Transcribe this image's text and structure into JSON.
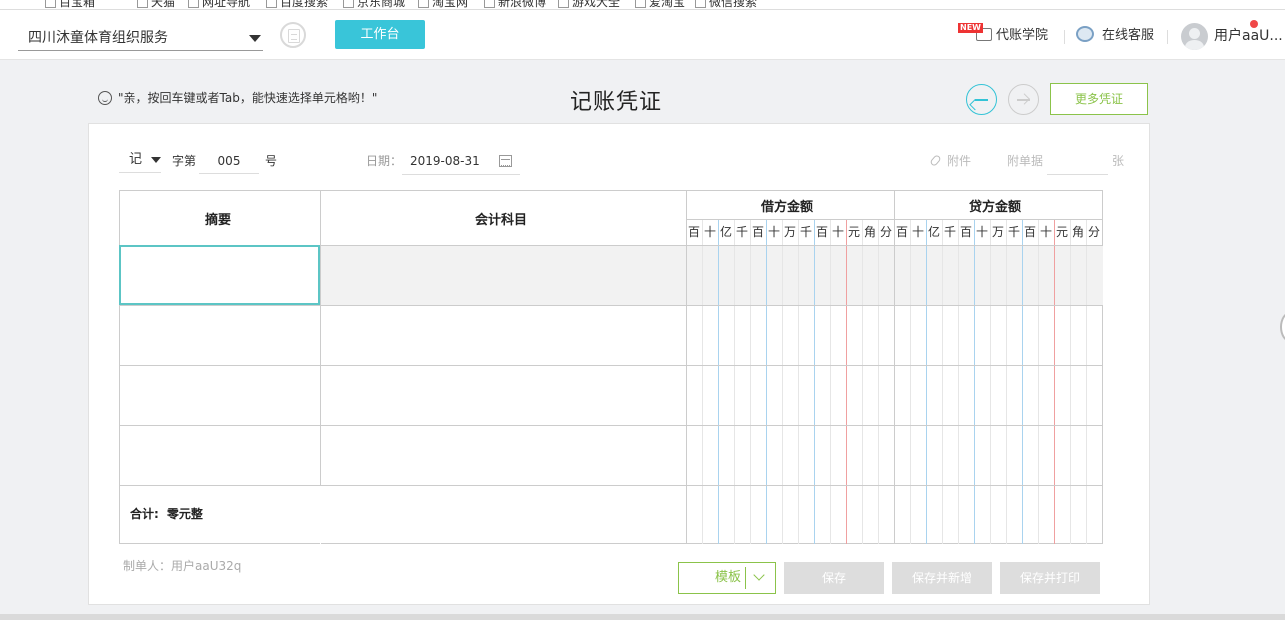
{
  "bookmarks": [
    "百宝箱",
    "天猫",
    "网址导航",
    "百度搜索",
    "京东商城",
    "淘宝网",
    "新浪微博",
    "游戏大全",
    "爱淘宝",
    "微信搜索"
  ],
  "header": {
    "company": "四川沐童体育组织服务",
    "workbench": "工作台",
    "academy_badge": "NEW",
    "academy": "代账学院",
    "service": "在线客服",
    "user": "用户aaU..."
  },
  "voucher": {
    "tip": "\"亲，按回车键或者Tab，能快速选择单元格哟！\"",
    "title": "记账凭证",
    "more": "更多凭证",
    "type": "记",
    "zi_di": "字第",
    "number": "005",
    "hao": "号",
    "date_label": "日期：",
    "date": "2019-08-31",
    "attach": "附件",
    "attach_doc": "附单据",
    "attach_unit": "张",
    "col_summary": "摘要",
    "col_subject": "会计科目",
    "col_debit": "借方金额",
    "col_credit": "贷方金额",
    "units": [
      "百",
      "十",
      "亿",
      "千",
      "百",
      "十",
      "万",
      "千",
      "百",
      "十",
      "元",
      "角",
      "分"
    ],
    "total_label": "合计:",
    "total_value": "零元整",
    "maker": "制单人：用户aaU32q"
  },
  "actions": {
    "template": "模板",
    "save": "保存",
    "save_new": "保存并新增",
    "save_print": "保存并打印"
  },
  "colors": {
    "accent": "#39c5d9",
    "green": "#8bc34a",
    "grid_blue": "#a9d3ef",
    "grid_red": "#f0a0a0"
  }
}
